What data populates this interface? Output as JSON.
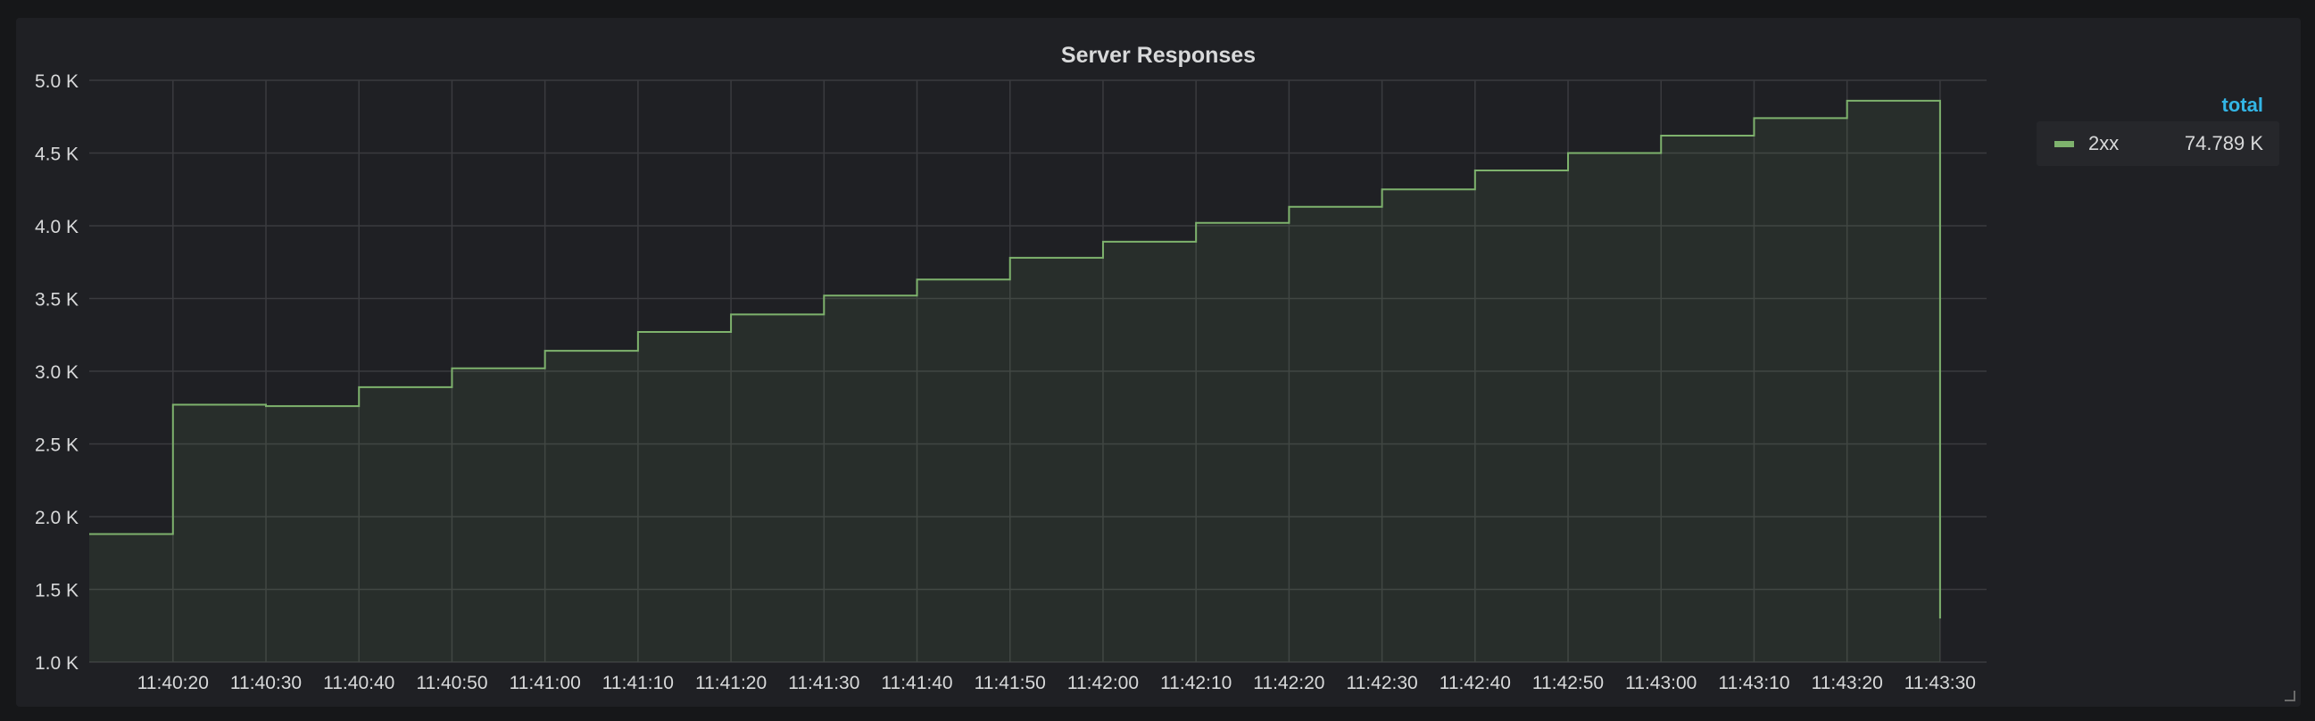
{
  "panel": {
    "title": "Server Responses"
  },
  "legend": {
    "header": "total",
    "items": [
      {
        "name": "2xx",
        "total": "74.789 K",
        "color": "#7eb26d"
      }
    ]
  },
  "chart_data": {
    "type": "area",
    "title": "Server Responses",
    "interpolation": "step-after",
    "grid": true,
    "legend_position": "right",
    "y_ticks": [
      "1.0 K",
      "1.5 K",
      "2.0 K",
      "2.5 K",
      "3.0 K",
      "3.5 K",
      "4.0 K",
      "4.5 K",
      "5.0 K"
    ],
    "ylim": [
      1000,
      5000
    ],
    "x_ticks": [
      "11:40:20",
      "11:40:30",
      "11:40:40",
      "11:40:50",
      "11:41:00",
      "11:41:10",
      "11:41:20",
      "11:41:30",
      "11:41:40",
      "11:41:50",
      "11:42:00",
      "11:42:10",
      "11:42:20",
      "11:42:30",
      "11:42:40",
      "11:42:50",
      "11:43:00",
      "11:43:10",
      "11:43:20",
      "11:43:30"
    ],
    "xlim": [
      "11:40:11",
      "11:43:35"
    ],
    "series": [
      {
        "name": "2xx",
        "color": "#7eb26d",
        "points": [
          {
            "x": "11:40:11",
            "y": 1880
          },
          {
            "x": "11:40:20",
            "y": 2770
          },
          {
            "x": "11:40:30",
            "y": 2760
          },
          {
            "x": "11:40:40",
            "y": 2890
          },
          {
            "x": "11:40:50",
            "y": 3020
          },
          {
            "x": "11:41:00",
            "y": 3140
          },
          {
            "x": "11:41:10",
            "y": 3270
          },
          {
            "x": "11:41:20",
            "y": 3390
          },
          {
            "x": "11:41:30",
            "y": 3520
          },
          {
            "x": "11:41:40",
            "y": 3630
          },
          {
            "x": "11:41:50",
            "y": 3780
          },
          {
            "x": "11:42:00",
            "y": 3890
          },
          {
            "x": "11:42:10",
            "y": 4020
          },
          {
            "x": "11:42:20",
            "y": 4130
          },
          {
            "x": "11:42:30",
            "y": 4250
          },
          {
            "x": "11:42:40",
            "y": 4380
          },
          {
            "x": "11:42:50",
            "y": 4500
          },
          {
            "x": "11:43:00",
            "y": 4620
          },
          {
            "x": "11:43:10",
            "y": 4740
          },
          {
            "x": "11:43:20",
            "y": 4860
          },
          {
            "x": "11:43:30",
            "y": 1300
          }
        ]
      }
    ]
  }
}
